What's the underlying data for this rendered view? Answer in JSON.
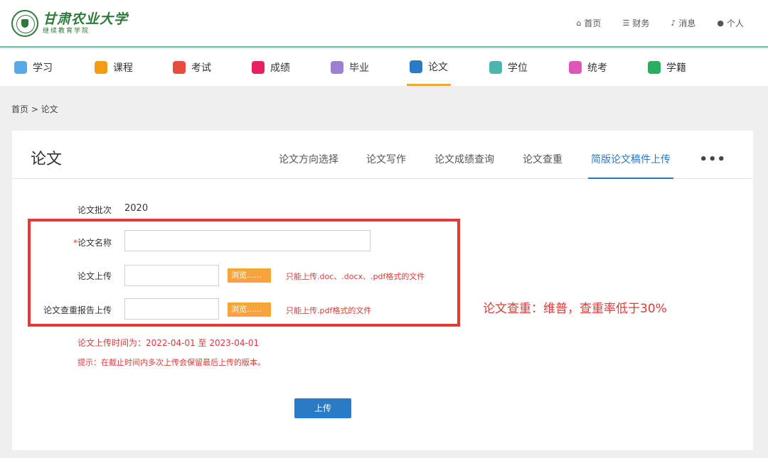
{
  "header": {
    "logo_title": "甘肃农业大学",
    "logo_subtitle": "继续教育学院",
    "links": [
      {
        "icon": "home-icon",
        "label": "首页"
      },
      {
        "icon": "database-icon",
        "label": "财务"
      },
      {
        "icon": "bell-icon",
        "label": "消息"
      },
      {
        "icon": "user-icon",
        "label": "个人"
      }
    ]
  },
  "nav": {
    "items": [
      {
        "label": "学习",
        "icon": "study-icon",
        "color": "#5aa9e6"
      },
      {
        "label": "课程",
        "icon": "course-icon",
        "color": "#f39c12"
      },
      {
        "label": "考试",
        "icon": "exam-icon",
        "color": "#e74c3c"
      },
      {
        "label": "成绩",
        "icon": "score-icon",
        "color": "#e91e63"
      },
      {
        "label": "毕业",
        "icon": "graduation-icon",
        "color": "#9b7fd4"
      },
      {
        "label": "论文",
        "icon": "thesis-icon",
        "color": "#2a7bc4"
      },
      {
        "label": "学位",
        "icon": "degree-icon",
        "color": "#4db6ac"
      },
      {
        "label": "统考",
        "icon": "unified-exam-icon",
        "color": "#e056b8"
      },
      {
        "label": "学籍",
        "icon": "enrollment-icon",
        "color": "#27ae60"
      }
    ],
    "active_index": 5
  },
  "breadcrumb": "首页 > 论文",
  "panel": {
    "title": "论文",
    "tabs": [
      "论文方向选择",
      "论文写作",
      "论文成绩查询",
      "论文查重",
      "简版论文稿件上传"
    ],
    "active_tab": "简版论文稿件上传",
    "more": "•••"
  },
  "form": {
    "batch_label": "论文批次",
    "batch_value": "2020",
    "required_mark": "*",
    "name_label": "论文名称",
    "name_value": "",
    "upload_label": "论文上传",
    "upload_value": "",
    "report_label": "论文查重报告上传",
    "report_value": "",
    "browse_label": "浏览......",
    "upload_hint": "只能上传.doc、.docx、.pdf格式的文件",
    "report_hint": "只能上传.pdf格式的文件",
    "time_line": "论文上传时间为：2022-04-01 至 2023-04-01",
    "tip_line": "提示：在截止时间内多次上传会保留最后上传的版本。",
    "submit_label": "上传"
  },
  "annotation": {
    "text": "论文查重：维普，查重率低于30%",
    "color": "#e53935"
  }
}
